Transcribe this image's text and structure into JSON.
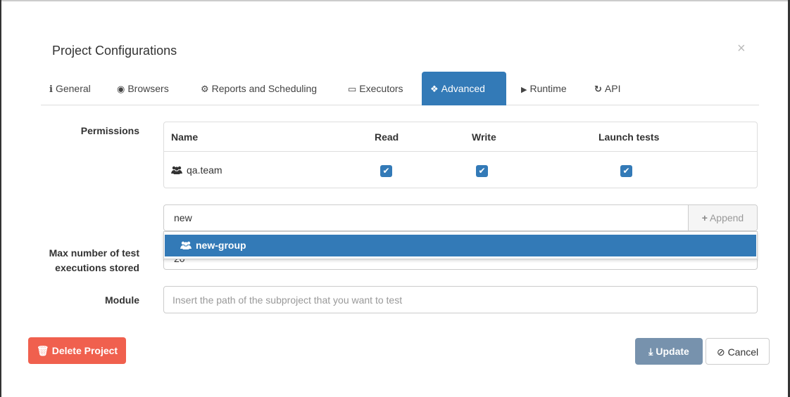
{
  "dialog": {
    "title": "Project Configurations",
    "close_symbol": "×"
  },
  "tabs": [
    {
      "label": "General",
      "icon": "info-icon",
      "glyph": "i",
      "active": false
    },
    {
      "label": "Browsers",
      "icon": "globe-icon",
      "glyph": "◉",
      "active": false
    },
    {
      "label": "Reports and Scheduling",
      "icon": "cogs-icon",
      "glyph": "⚙",
      "active": false
    },
    {
      "label": "Executors",
      "icon": "laptop-icon",
      "glyph": "▭",
      "active": false
    },
    {
      "label": "Advanced",
      "icon": "cubes-icon",
      "glyph": "❖",
      "active": true
    },
    {
      "label": "Runtime",
      "icon": "play-icon",
      "glyph": "▶",
      "active": false
    },
    {
      "label": "API",
      "icon": "refresh-icon",
      "glyph": "↻",
      "active": false
    }
  ],
  "permissions": {
    "label": "Permissions",
    "columns": [
      "Name",
      "Read",
      "Write",
      "Launch tests"
    ],
    "rows": [
      {
        "name": "qa.team",
        "icon": "group-icon",
        "read": true,
        "write": true,
        "launch_tests": true
      }
    ],
    "check_glyph": "✔"
  },
  "search": {
    "value": "new",
    "append_label": "Append",
    "append_glyph": "+"
  },
  "dropdown": {
    "items": [
      {
        "label": "new-group",
        "icon": "group-icon"
      }
    ]
  },
  "max_executions": {
    "label_line1": "Max number of test",
    "label_line2": "executions stored",
    "value": "20"
  },
  "module": {
    "label": "Module",
    "placeholder": "Insert the path of the subproject that you want to test"
  },
  "buttons": {
    "delete_label": "Delete Project",
    "update_label": "Update",
    "cancel_label": "Cancel",
    "delete_glyph": "🗑",
    "update_glyph": "⤓",
    "cancel_glyph": "⊘"
  },
  "colors": {
    "primary": "#337ab7",
    "danger": "#f0604e",
    "update_disabled": "#7792ad"
  }
}
